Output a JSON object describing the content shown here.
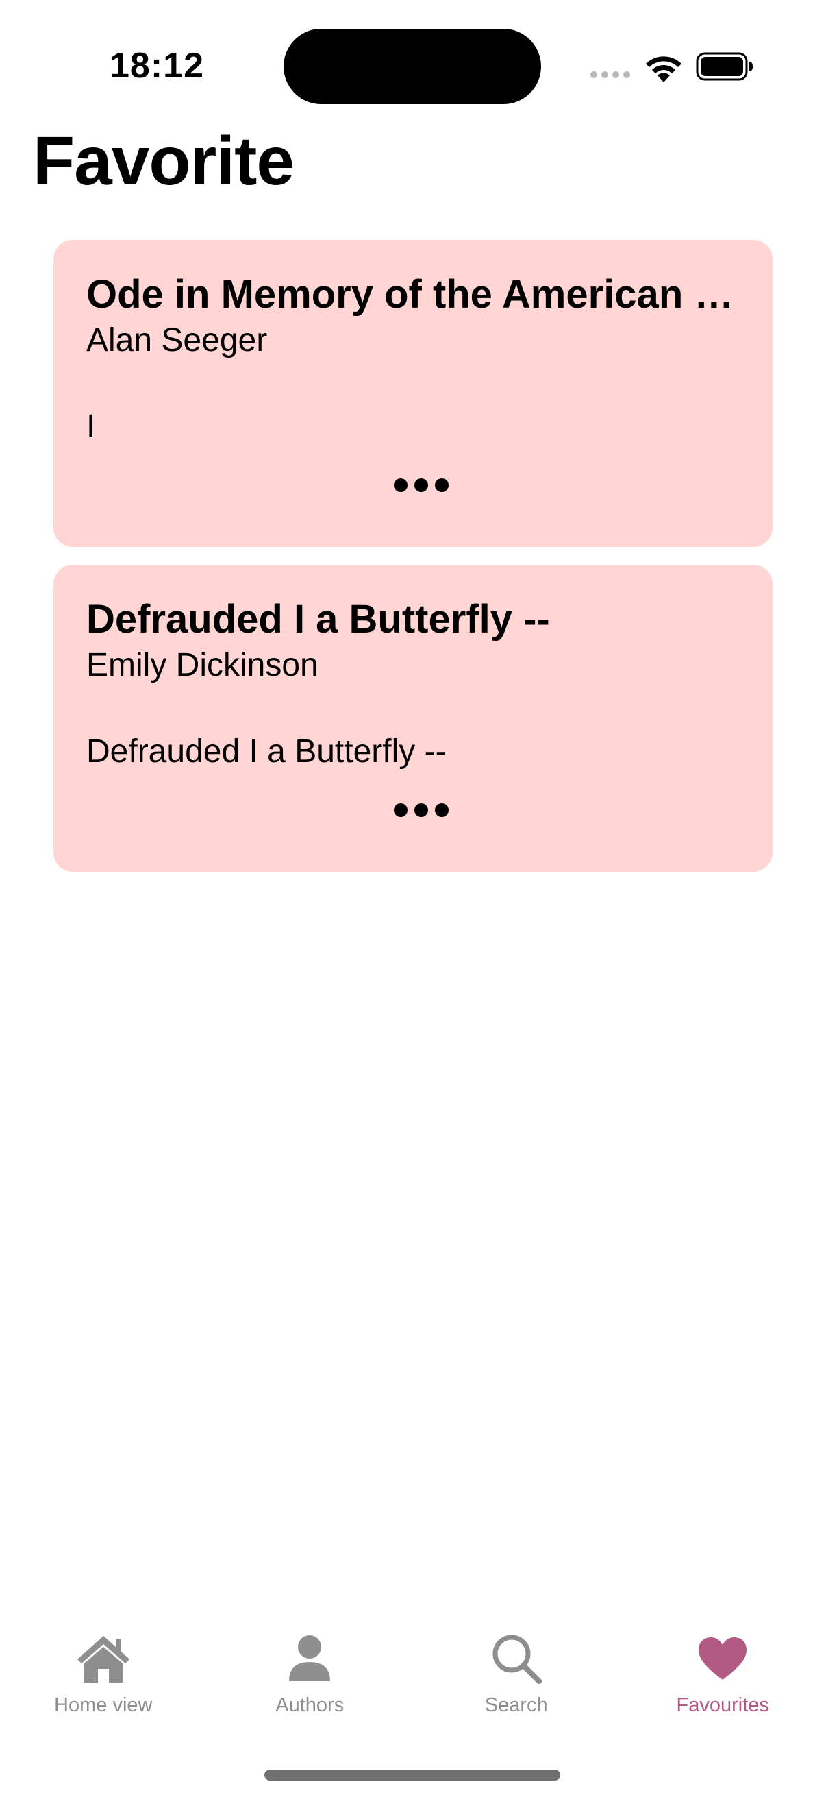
{
  "status_bar": {
    "time": "18:12"
  },
  "page": {
    "title": "Favorite"
  },
  "cards": [
    {
      "title": "Ode in Memory of the American Volunteers Fallen for France",
      "author": "Alan Seeger",
      "excerpt": "I"
    },
    {
      "title": "Defrauded I a Butterfly --",
      "author": "Emily Dickinson",
      "excerpt": "Defrauded I a Butterfly --"
    }
  ],
  "tab_bar": {
    "items": [
      {
        "label": "Home view",
        "icon": "house-icon",
        "active": false
      },
      {
        "label": "Authors",
        "icon": "person-icon",
        "active": false
      },
      {
        "label": "Search",
        "icon": "magnifier-icon",
        "active": false
      },
      {
        "label": "Favourites",
        "icon": "heart-icon",
        "active": true
      }
    ]
  },
  "colors": {
    "card_background": "#ffd6d4",
    "active_tab": "#b25a84",
    "inactive_tab": "#8e8e8e"
  }
}
